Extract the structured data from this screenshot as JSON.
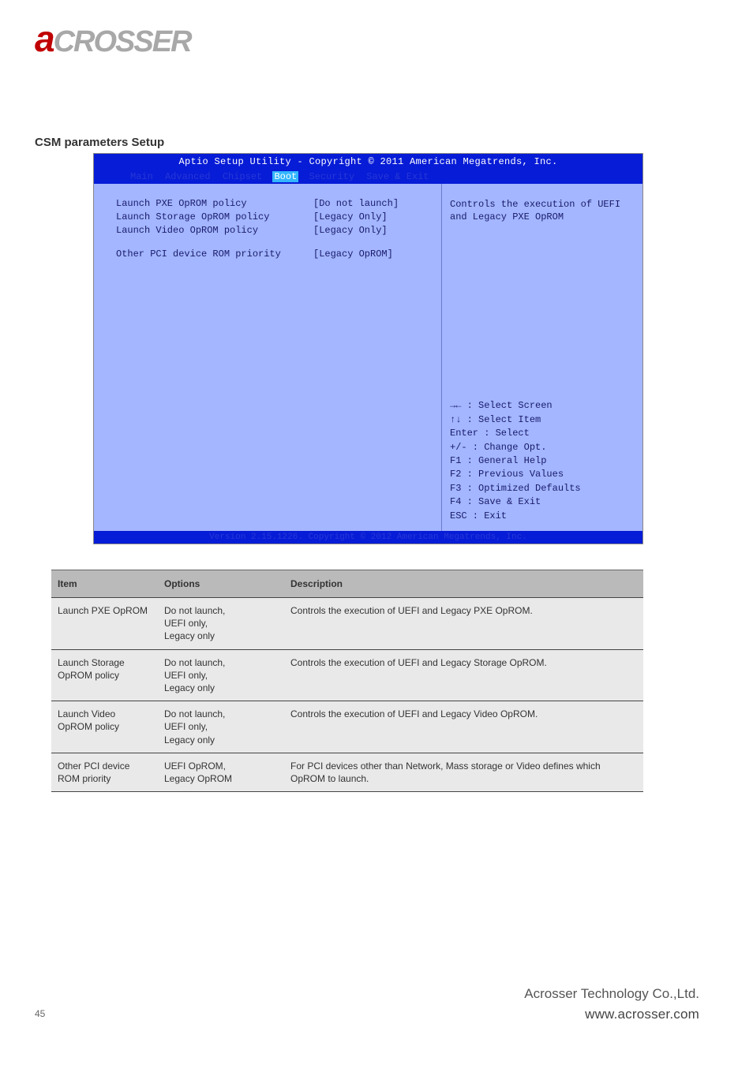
{
  "logo": {
    "first": "a",
    "rest": "CROSSER"
  },
  "section_title": "CSM parameters Setup",
  "bios": {
    "title": "Aptio Setup Utility - Copyright © 2011 American Megatrends, Inc.",
    "tabs": [
      "Main",
      "Advanced",
      "Chipset",
      "Boot",
      "Security",
      "Save & Exit"
    ],
    "active_tab": "Boot",
    "settings": [
      {
        "label": "Launch PXE OpROM policy",
        "value": "[Do not launch]"
      },
      {
        "label": "Launch Storage OpROM policy",
        "value": "[Legacy Only]"
      },
      {
        "label": "Launch Video OpROM policy",
        "value": "[Legacy Only]"
      },
      {
        "label": "Other PCI device ROM priority",
        "value": "[Legacy OpROM]"
      }
    ],
    "help_text": "Controls the execution of UEFI and Legacy PXE OpROM",
    "legend": [
      "→← : Select Screen",
      "↑↓ : Select Item",
      "Enter : Select",
      "+/- : Change Opt.",
      "F1 : General Help",
      "F2 : Previous Values",
      "F3 : Optimized Defaults",
      "F4 : Save & Exit",
      "ESC : Exit"
    ],
    "footer": "Version 2.15.1226. Copyright © 2012 American Megatrends, Inc."
  },
  "table": {
    "headers": [
      "Item",
      "Options",
      "Description"
    ],
    "rows": [
      {
        "item": "Launch PXE OpROM",
        "options": "Do not launch,\nUEFI only,\nLegacy only",
        "desc": "Controls the execution of UEFI and Legacy PXE OpROM."
      },
      {
        "item": "Launch Storage OpROM policy",
        "options": "Do not launch,\nUEFI only,\nLegacy only",
        "desc": "Controls the execution of UEFI and Legacy Storage OpROM."
      },
      {
        "item": "Launch Video OpROM policy",
        "options": "Do not launch,\nUEFI only,\nLegacy only",
        "desc": "Controls the execution of UEFI and Legacy Video OpROM."
      },
      {
        "item": "Other PCI device ROM priority",
        "options": "UEFI OpROM,\nLegacy OpROM",
        "desc": "For PCI devices other than Network, Mass storage or Video defines which OpROM to launch."
      }
    ]
  },
  "footer": {
    "company": "Acrosser Technology Co.,Ltd.",
    "url": "www.acrosser.com"
  },
  "page_number": "45"
}
